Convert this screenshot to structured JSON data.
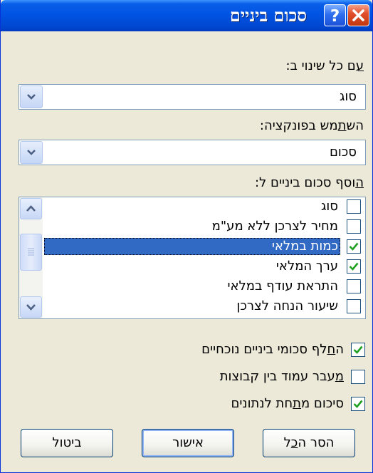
{
  "window": {
    "title": "סכום ביניים",
    "close_icon": "close-icon",
    "help_icon": "help-question-icon",
    "title_color": "#0054e3"
  },
  "change_label": "עם כל שינוי ב:",
  "change_value": "סוג",
  "function_label": "השתמש בפונקציה:",
  "function_value": "סכום",
  "add_label": "הוסף סכום ביניים ל:",
  "list_items": [
    {
      "label": "סוג",
      "checked": false,
      "selected": false
    },
    {
      "label": "מחיר לצרכן ללא מע\"מ",
      "checked": false,
      "selected": false
    },
    {
      "label": "כמות במלאי",
      "checked": true,
      "selected": true
    },
    {
      "label": "ערך המלאי",
      "checked": true,
      "selected": false
    },
    {
      "label": "התראת עודף במלאי",
      "checked": false,
      "selected": false
    },
    {
      "label": "שיעור הנחה לצרכן",
      "checked": false,
      "selected": false
    }
  ],
  "options": [
    {
      "label": "החלף סכומי ביניים נוכחיים",
      "checked": true
    },
    {
      "label": "מעבר עמוד בין קבוצות",
      "checked": false
    },
    {
      "label": "סיכום מתחת לנתונים",
      "checked": true
    }
  ],
  "buttons": {
    "remove_all": "הסר הכל",
    "ok": "אישור",
    "cancel": "ביטול"
  },
  "colors": {
    "selection": "#316ac5",
    "check": "#21a121",
    "dialog_bg": "#ece9d8"
  }
}
